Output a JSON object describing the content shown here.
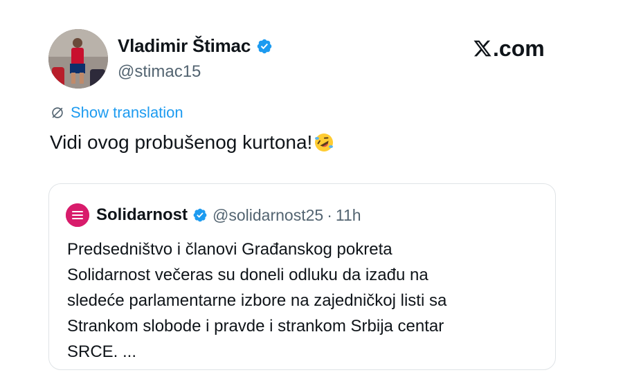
{
  "tweet": {
    "author_name": "Vladimir Štimac",
    "author_handle": "@stimac15",
    "show_translation": "Show translation",
    "text": "Vidi ovog probušenog kurtona!",
    "emoji": "rolling-on-the-floor-laughing"
  },
  "brand": {
    "domain_suffix": ".com"
  },
  "quote": {
    "author_name": "Solidarnost",
    "author_handle": "@solidarnost25",
    "separator": "·",
    "time": "11h",
    "lines": [
      "Predsedništvo i članovi Građanskog pokreta",
      "Solidarnost večeras su doneli odluku da izađu na",
      "sledeće parlamentarne izbore na zajedničkoj listi sa",
      "Strankom slobode i pravde i strankom Srbija centar",
      "SRCE. ..."
    ]
  },
  "colors": {
    "link": "#1d9bf0",
    "verified": "#1d9bf0",
    "muted": "#536471",
    "quote_avatar": "#d81b6b"
  },
  "icons": {
    "verified": "verified-badge-icon",
    "translate": "translate-icon",
    "logo": "x-logo-icon"
  }
}
